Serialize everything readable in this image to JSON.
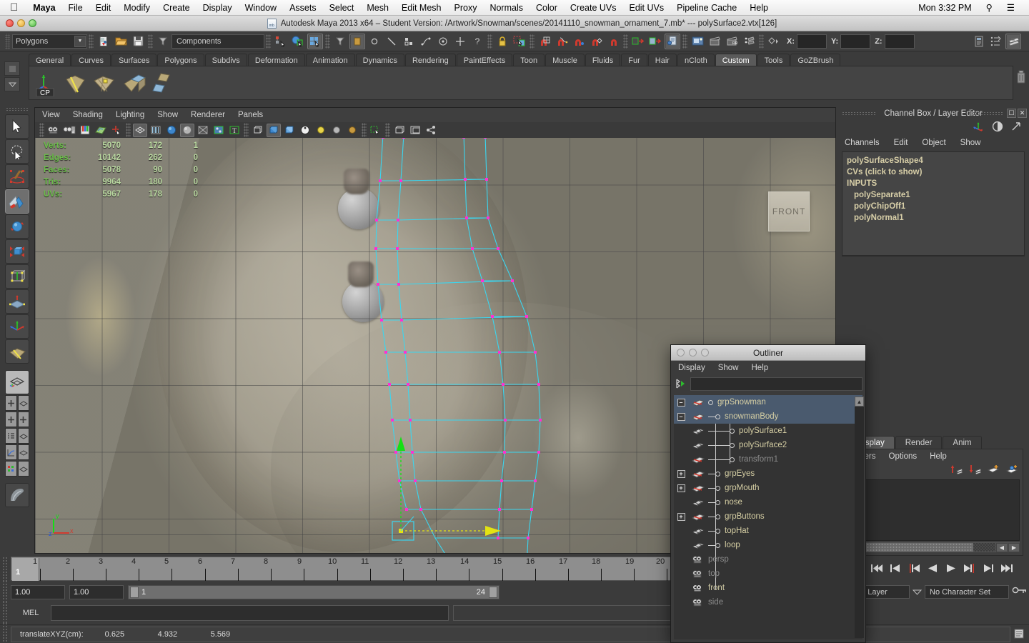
{
  "os_menu": {
    "apple": "apple-logo",
    "items": [
      "Maya",
      "File",
      "Edit",
      "Modify",
      "Create",
      "Display",
      "Window",
      "Assets",
      "Select",
      "Mesh",
      "Edit Mesh",
      "Proxy",
      "Normals",
      "Color",
      "Create UVs",
      "Edit UVs",
      "Pipeline Cache",
      "Help"
    ],
    "clock": "Mon 3:32 PM",
    "search_icon": "⌕",
    "list_icon": "☰"
  },
  "title_bar": {
    "title": "Autodesk Maya 2013 x64 – Student Version: /Artwork/Snowman/scenes/20141110_snowman_ornament_7.mb*   ---   polySurface2.vtx[126]"
  },
  "status_line": {
    "selection_mode": "Polygons",
    "components_field": "Components",
    "x_label": "X:",
    "y_label": "Y:",
    "z_label": "Z:",
    "x_value": "",
    "y_value": "",
    "z_value": ""
  },
  "shelf": {
    "tabs": [
      "General",
      "Curves",
      "Surfaces",
      "Polygons",
      "Subdivs",
      "Deformation",
      "Animation",
      "Dynamics",
      "Rendering",
      "PaintEffects",
      "Toon",
      "Muscle",
      "Fluids",
      "Fur",
      "Hair",
      "nCloth",
      "Custom",
      "Tools",
      "GoZBrush"
    ],
    "active_tab": "Custom",
    "buttons": [
      "CP",
      "crease-tool-icon",
      "multi-cut-icon",
      "bevel-icon",
      "detach-icon"
    ]
  },
  "viewport": {
    "menus": [
      "View",
      "Shading",
      "Lighting",
      "Show",
      "Renderer",
      "Panels"
    ],
    "orientation_label": "FRONT",
    "hud": {
      "rows": [
        {
          "label": "Verts:",
          "total": "5070",
          "selected": "172",
          "extra": "1"
        },
        {
          "label": "Edges:",
          "total": "10142",
          "selected": "262",
          "extra": "0"
        },
        {
          "label": "Faces:",
          "total": "5078",
          "selected": "90",
          "extra": "0"
        },
        {
          "label": "Tris:",
          "total": "9964",
          "selected": "180",
          "extra": "0"
        },
        {
          "label": "UVs:",
          "total": "5967",
          "selected": "178",
          "extra": "0"
        }
      ]
    },
    "axis_gizmo": {
      "x": "x",
      "y": "y",
      "z": "z"
    },
    "colors": {
      "mesh_wire": "#3ad6f0",
      "vertex": "#ff2fd0",
      "manip_y": "#14e014",
      "manip_x": "#e3e312"
    }
  },
  "channel_box": {
    "title": "Channel Box / Layer Editor",
    "menus": [
      "Channels",
      "Edit",
      "Object",
      "Show"
    ],
    "rows": [
      "polySurfaceShape4",
      "CVs (click to show)",
      "INPUTS"
    ],
    "inputs": [
      "polySeparate1",
      "polyChipOff1",
      "polyNormal1"
    ]
  },
  "layer_editor": {
    "tabs": [
      "Display",
      "Render",
      "Anim"
    ],
    "active_tab": "Display",
    "menus": [
      "Layers",
      "Options",
      "Help"
    ]
  },
  "outliner": {
    "title": "Outliner",
    "menus": [
      "Display",
      "Show",
      "Help"
    ],
    "search_value": "",
    "items": [
      {
        "name": "grpSnowman",
        "depth": 0,
        "icon": "transform-icon",
        "expander": "-",
        "selected": true,
        "dim": false
      },
      {
        "name": "snowmanBody",
        "depth": 1,
        "icon": "transform-icon",
        "expander": "-",
        "selected": true,
        "dim": false
      },
      {
        "name": "polySurface1",
        "depth": 2,
        "icon": "mesh-icon",
        "expander": "",
        "selected": false,
        "dim": false
      },
      {
        "name": "polySurface2",
        "depth": 2,
        "icon": "mesh-icon",
        "expander": "",
        "selected": false,
        "dim": false
      },
      {
        "name": "transform1",
        "depth": 2,
        "icon": "transform-icon",
        "expander": "",
        "selected": false,
        "dim": true
      },
      {
        "name": "grpEyes",
        "depth": 1,
        "icon": "transform-icon",
        "expander": "+",
        "selected": false,
        "dim": false
      },
      {
        "name": "grpMouth",
        "depth": 1,
        "icon": "transform-icon",
        "expander": "+",
        "selected": false,
        "dim": false
      },
      {
        "name": "nose",
        "depth": 1,
        "icon": "mesh-icon",
        "expander": "",
        "selected": false,
        "dim": false
      },
      {
        "name": "grpButtons",
        "depth": 1,
        "icon": "transform-icon",
        "expander": "+",
        "selected": false,
        "dim": false
      },
      {
        "name": "topHat",
        "depth": 1,
        "icon": "mesh-icon",
        "expander": "",
        "selected": false,
        "dim": false
      },
      {
        "name": "loop",
        "depth": 1,
        "icon": "mesh-icon",
        "expander": "",
        "selected": false,
        "dim": false
      },
      {
        "name": "persp",
        "depth": 0,
        "icon": "camera-icon",
        "expander": "",
        "selected": false,
        "dim": true
      },
      {
        "name": "top",
        "depth": 0,
        "icon": "camera-icon",
        "expander": "",
        "selected": false,
        "dim": true
      },
      {
        "name": "front",
        "depth": 0,
        "icon": "camera-icon",
        "expander": "",
        "selected": false,
        "dim": false
      },
      {
        "name": "side",
        "depth": 0,
        "icon": "camera-icon",
        "expander": "",
        "selected": false,
        "dim": true
      }
    ]
  },
  "time_slider": {
    "current_frame": "1",
    "ticks": [
      "1",
      "2",
      "3",
      "4",
      "5",
      "6",
      "7",
      "8",
      "9",
      "10",
      "11",
      "12",
      "13",
      "14",
      "15",
      "16",
      "17",
      "18",
      "19",
      "20"
    ]
  },
  "range_slider": {
    "start_field": "1.00",
    "end_field": "1.00",
    "range_start": "1",
    "range_end": "24"
  },
  "command_line": {
    "language": "MEL",
    "input_value": "",
    "output_value": ""
  },
  "help_line": {
    "label": "translateXYZ(cm):",
    "values": [
      "0.625",
      "4.932",
      "5.569"
    ]
  },
  "character_bar": {
    "layer_field": "m Layer",
    "character_set": "No Character Set"
  }
}
